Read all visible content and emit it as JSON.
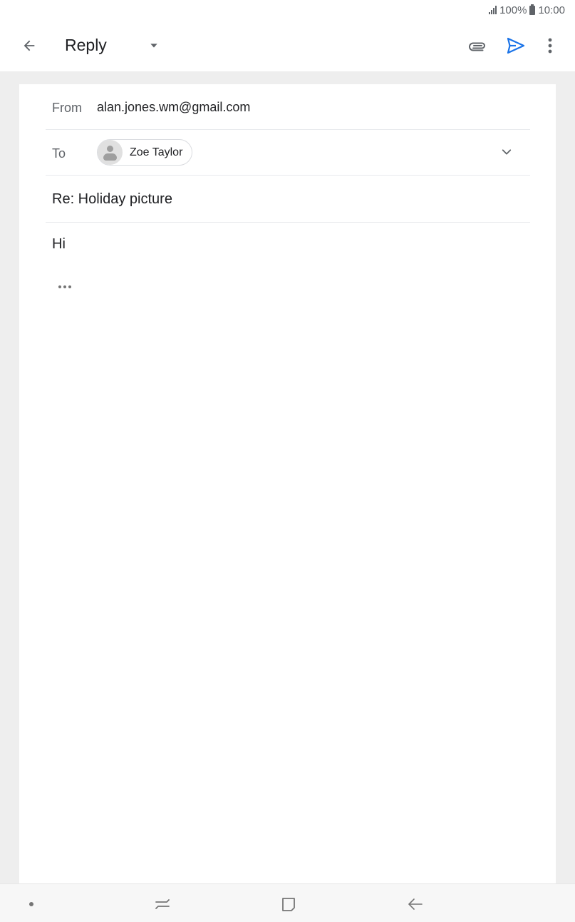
{
  "status_bar": {
    "battery": "100%",
    "time": "10:00"
  },
  "app_bar": {
    "title": "Reply",
    "icons": {
      "back": "arrow-left-icon",
      "dropdown": "caret-down-icon",
      "attach": "paperclip-icon",
      "send": "send-icon",
      "more": "more-vert-icon"
    },
    "send_color": "#1a73e8"
  },
  "compose": {
    "from_label": "From",
    "from_value": "alan.jones.wm@gmail.com",
    "to_label": "To",
    "to_recipient": "Zoe Taylor",
    "subject": "Re: Holiday picture",
    "body": "Hi"
  },
  "nav_bar": {
    "icons": [
      "dot-icon",
      "recent-apps-icon",
      "home-icon",
      "back-icon"
    ]
  }
}
